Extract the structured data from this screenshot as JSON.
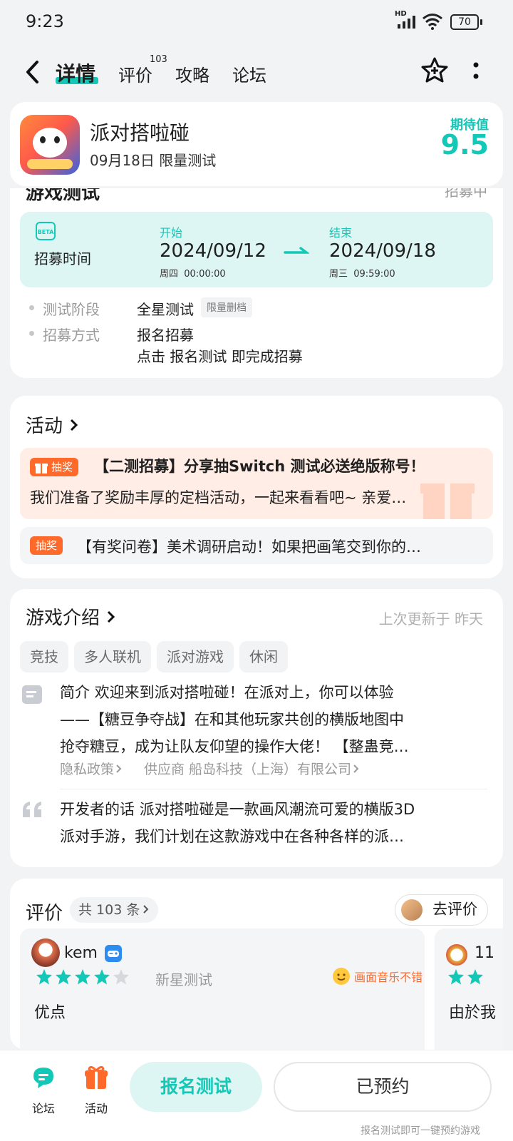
{
  "status_bar": {
    "time": "9:23",
    "hd": "HD",
    "battery": "70"
  },
  "nav": {
    "tabs": [
      {
        "label": "详情",
        "active": true
      },
      {
        "label": "评价",
        "badge": "103"
      },
      {
        "label": "攻略"
      },
      {
        "label": "论坛"
      }
    ]
  },
  "app": {
    "name": "派对搭啦碰",
    "subtitle": "09月18日 限量测试",
    "expect_label": "期待值",
    "expect_value": "9.5"
  },
  "test_section": {
    "partial_title": "游戏测试",
    "partial_right": "招募中",
    "beta_badge": "BETA",
    "recruit_label": "招募时间",
    "start_label": "开始",
    "start_date": "2024/09/12",
    "start_sub": "周四  00:00:00",
    "end_label": "结束",
    "end_date": "2024/09/18",
    "end_sub": "周三  09:59:00",
    "stage_label": "测试阶段",
    "stage_value": "全星测试",
    "stage_tag": "限量删档",
    "method_label": "招募方式",
    "method_value": "报名招募",
    "method_desc": "点击 报名测试 即完成招募"
  },
  "activity": {
    "title": "活动",
    "items": [
      {
        "tag": "抽奖",
        "title": "【二测招募】分享抽Switch 测试必送绝版称号！",
        "desc": "我们准备了奖励丰厚的定档活动，一起来看看吧~ 亲爱…"
      },
      {
        "tag": "抽奖",
        "title": "【有奖问卷】美术调研启动！如果把画笔交到你的…"
      }
    ]
  },
  "intro": {
    "title": "游戏介绍",
    "updated": "上次更新于 昨天",
    "tags": [
      "竞技",
      "多人联机",
      "派对游戏",
      "休闲"
    ],
    "brief_label": "简介",
    "brief_line1": "欢迎来到派对搭啦碰！在派对上，你可以体验",
    "brief_line2": "——【糖豆争夺战】在和其他玩家共创的横版地图中",
    "brief_line3": "抢夺糖豆，成为让队友仰望的操作大佬！ 【整蛊竞…",
    "privacy": "隐私政策",
    "supplier": "供应商 船岛科技（上海）有限公司",
    "dev_label": "开发者的话",
    "dev_line1": "派对搭啦碰是一款画风潮流可爱的横版3D",
    "dev_line2": "派对手游，我们计划在这款游戏中在各种各样的派…"
  },
  "reviews": {
    "title": "评价",
    "count": "共 103 条",
    "go_review": "去评价",
    "items": [
      {
        "user": "kem",
        "rating": 4,
        "stage": "新星测试",
        "badge": "画面音乐不错",
        "content": "优点"
      },
      {
        "user": "11",
        "content": "由於我"
      }
    ]
  },
  "bottom": {
    "forum": "论坛",
    "activity": "活动",
    "signup": "报名测试",
    "reserved": "已预约",
    "note": "报名测试即可一键预约游戏"
  },
  "colors": {
    "accent": "#14C8B8",
    "orange": "#FF6A2B",
    "teal_bg": "#DDF6F3"
  }
}
